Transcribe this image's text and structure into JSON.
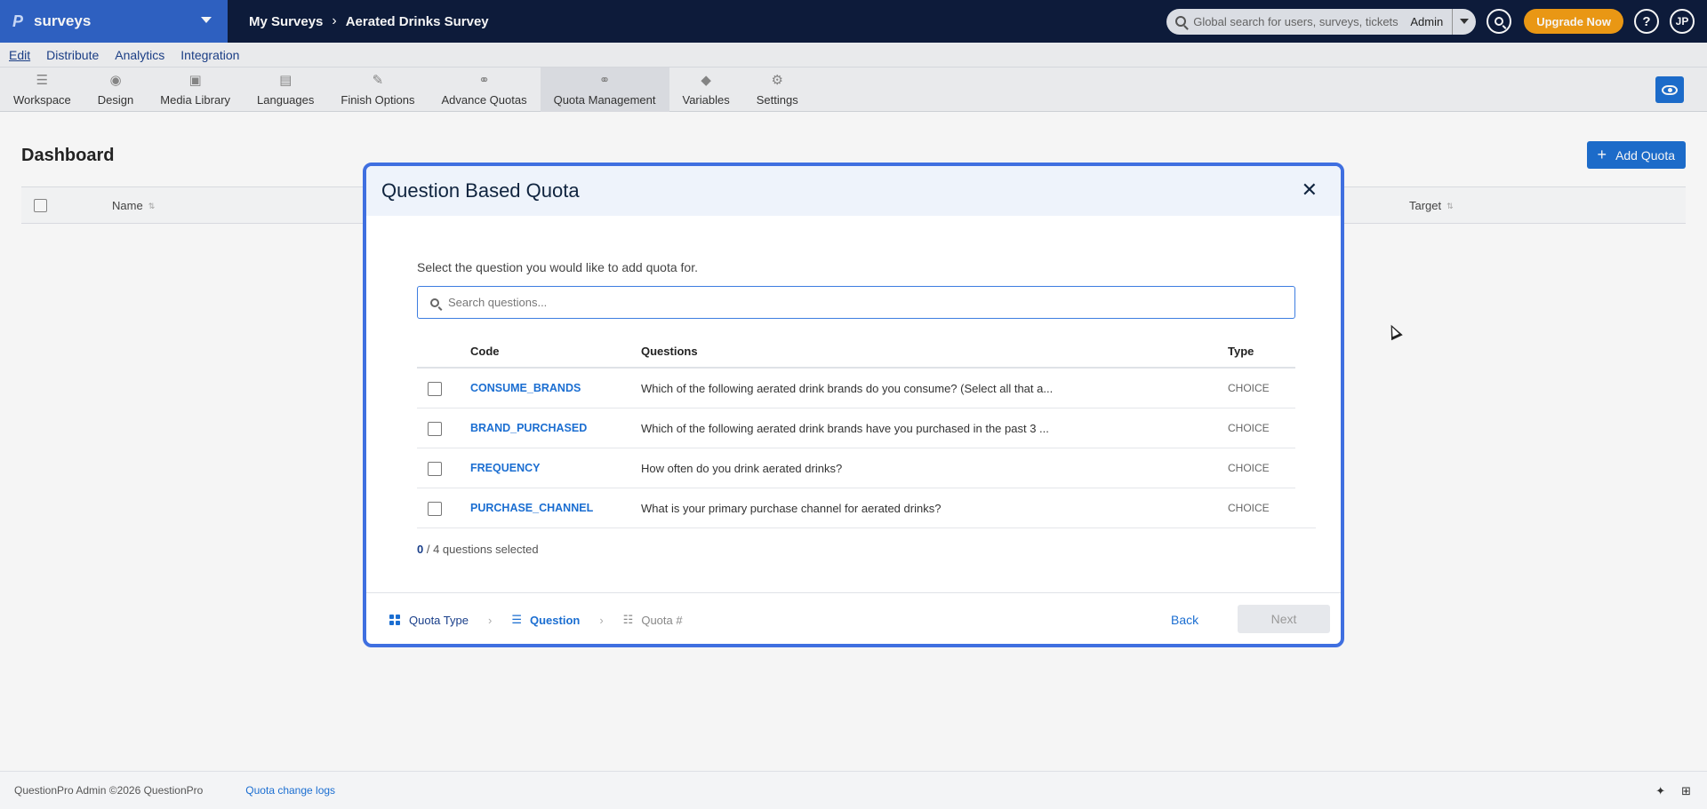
{
  "topbar": {
    "brand_logo": "P",
    "brand_name": "surveys",
    "breadcrumb": [
      "My Surveys",
      "Aerated Drinks Survey"
    ],
    "search_placeholder": "Global search for users, surveys, tickets",
    "search_scope": "Admin",
    "upgrade_label": "Upgrade Now",
    "help_label": "?",
    "user_initials": "JP"
  },
  "menu": {
    "items": [
      "Edit",
      "Distribute",
      "Analytics",
      "Integration"
    ],
    "active": "Edit"
  },
  "toolbar": {
    "items": [
      {
        "label": "Workspace",
        "icon": "workspace-icon"
      },
      {
        "label": "Design",
        "icon": "palette-icon"
      },
      {
        "label": "Media Library",
        "icon": "image-icon"
      },
      {
        "label": "Languages",
        "icon": "translate-icon"
      },
      {
        "label": "Finish Options",
        "icon": "magic-wand-icon"
      },
      {
        "label": "Advance Quotas",
        "icon": "advance-quota-icon"
      },
      {
        "label": "Quota Management",
        "icon": "quota-icon"
      },
      {
        "label": "Variables",
        "icon": "tag-icon"
      },
      {
        "label": "Settings",
        "icon": "gear-icon"
      }
    ],
    "active": "Quota Management"
  },
  "dashboard": {
    "title": "Dashboard",
    "add_label": "Add Quota",
    "columns": {
      "name": "Name",
      "target": "Target"
    }
  },
  "modal": {
    "title": "Question Based Quota",
    "prompt": "Select the question you would like to add quota for.",
    "search_placeholder": "Search questions...",
    "columns": {
      "code": "Code",
      "questions": "Questions",
      "type": "Type"
    },
    "rows": [
      {
        "code": "CONSUME_BRANDS",
        "question": "Which of the following aerated drink brands do you consume? (Select all that a...",
        "type": "CHOICE"
      },
      {
        "code": "BRAND_PURCHASED",
        "question": "Which of the following aerated drink brands have you purchased in the past 3 ...",
        "type": "CHOICE"
      },
      {
        "code": "FREQUENCY",
        "question": "How often do you drink aerated drinks?",
        "type": "CHOICE"
      },
      {
        "code": "PURCHASE_CHANNEL",
        "question": "What is your primary purchase channel for aerated drinks?",
        "type": "CHOICE"
      }
    ],
    "selected_count": "0",
    "total_label": "/ 4 questions selected",
    "steps": [
      {
        "label": "Quota Type",
        "state": "done"
      },
      {
        "label": "Question",
        "state": "current"
      },
      {
        "label": "Quota #",
        "state": "future"
      }
    ],
    "back_label": "Back",
    "next_label": "Next"
  },
  "footer": {
    "copyright": "QuestionPro Admin ©2026 QuestionPro",
    "link": "Quota change logs"
  },
  "colors": {
    "brand_blue": "#2e63c8",
    "navy": "#0b1a3a",
    "accent": "#1b6ed1",
    "upgrade": "#f39c12",
    "modal_border": "#3f6fe0"
  }
}
